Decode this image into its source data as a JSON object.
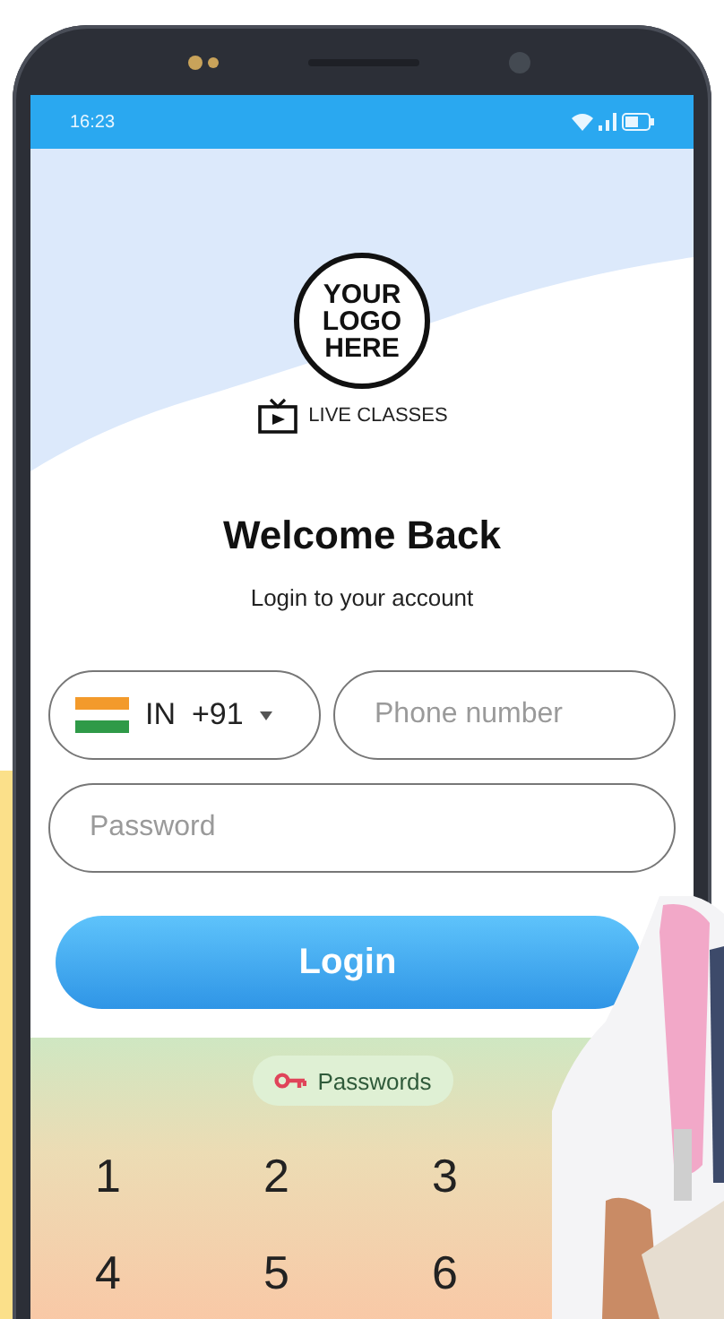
{
  "status_bar": {
    "time": "16:23"
  },
  "logo": {
    "text": "YOUR LOGO HERE",
    "tagline": "LIVE CLASSES"
  },
  "heading": "Welcome Back",
  "subheading": "Login to your account",
  "country_picker": {
    "country_code": "IN",
    "dial_code": "+91"
  },
  "phone_field": {
    "placeholder": "Phone number"
  },
  "password_field": {
    "placeholder": "Password"
  },
  "login_button": "Login",
  "keyboard": {
    "suggestion": "Passwords",
    "keys": [
      "1",
      "2",
      "3",
      "4",
      "5",
      "6"
    ]
  }
}
